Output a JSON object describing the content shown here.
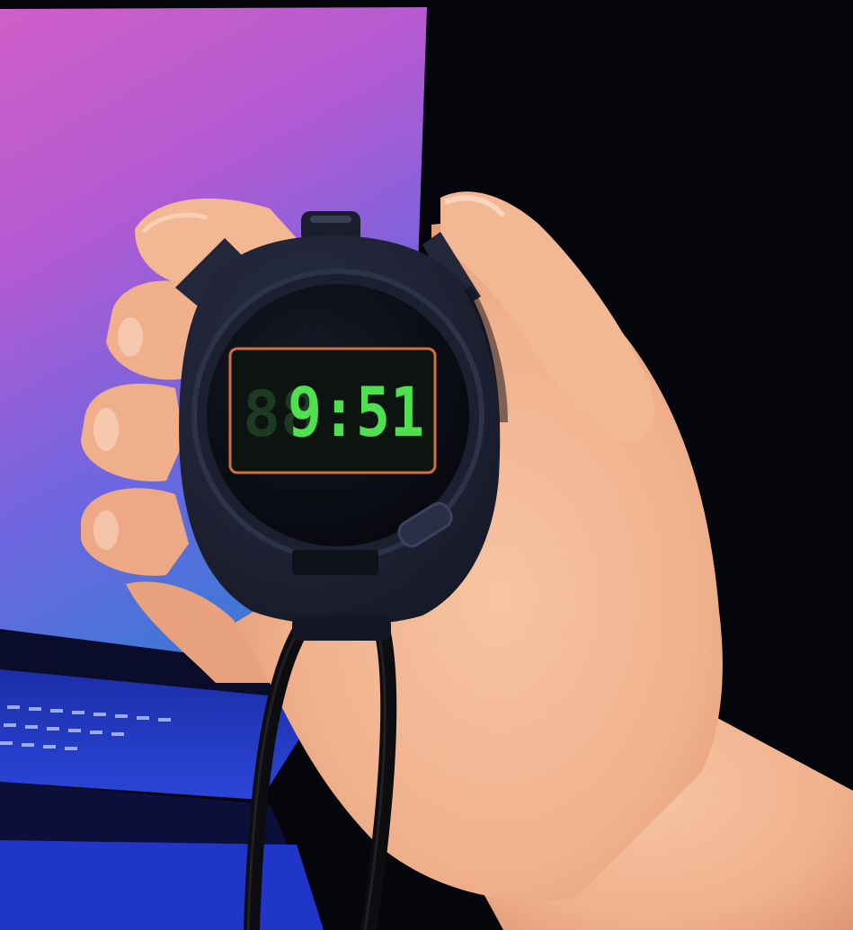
{
  "photo": {
    "subject": "hand-holding-stopwatch",
    "stopwatch": {
      "display": {
        "time": "9:51",
        "ghost_digits": "88",
        "digit_color": "#4fe050",
        "ghost_color": "#1d3a22",
        "frame_color": "#d0703a"
      },
      "body_color": "#1d2133"
    },
    "colors": {
      "background_dark": "#05060c",
      "screen_top": "#c85ac8",
      "screen_bottom": "#3a4fd8",
      "keyboard": "#2a3fd0",
      "skin": "#f0b48e",
      "skin_shadow": "#d88e6a",
      "cord": "#0d0d10"
    }
  }
}
